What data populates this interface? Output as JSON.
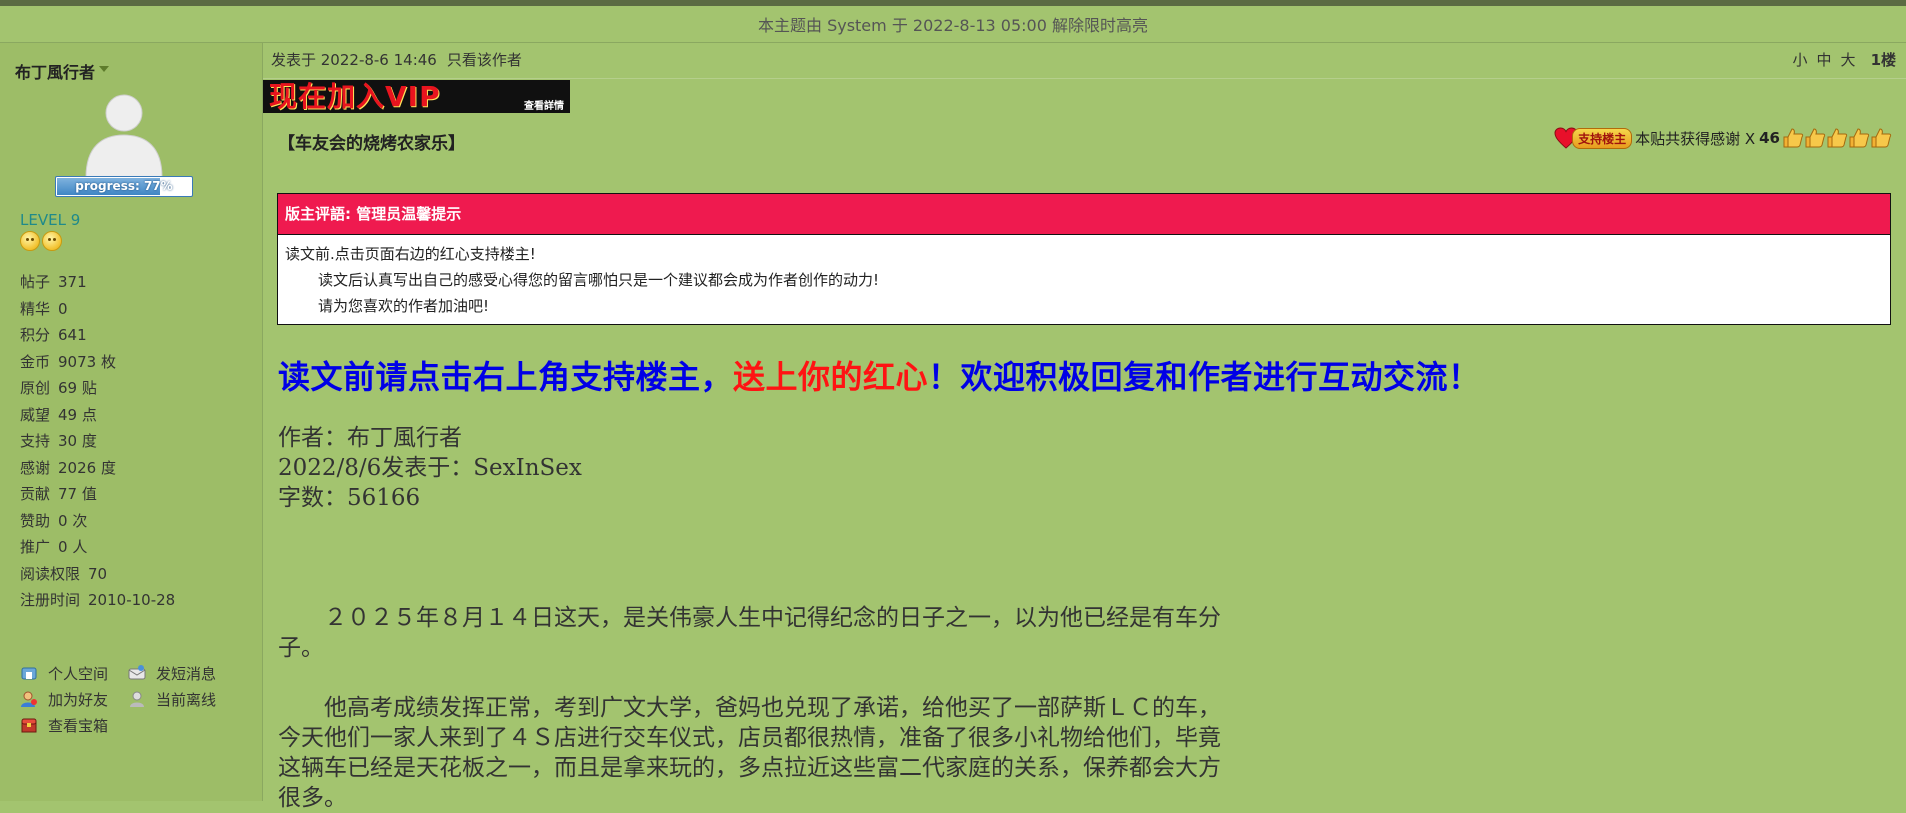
{
  "notice": "本主题由 System 于 2022-8-13 05:00 解除限时高亮",
  "author": {
    "name": "布丁風行者",
    "progress_label": "progress: 77%",
    "progress_value": 0.77,
    "level": "LEVEL 9",
    "stats": [
      {
        "key": "帖子",
        "value": "371"
      },
      {
        "key": "精华",
        "value": "0"
      },
      {
        "key": "积分",
        "value": "641"
      },
      {
        "key": "金币",
        "value": "9073 枚"
      },
      {
        "key": "原创",
        "value": "69 贴"
      },
      {
        "key": "威望",
        "value": "49 点"
      },
      {
        "key": "支持",
        "value": "30 度"
      },
      {
        "key": "感谢",
        "value": "2026 度"
      },
      {
        "key": "贡献",
        "value": "77 值"
      },
      {
        "key": "赞助",
        "value": "0 次"
      },
      {
        "key": "推广",
        "value": "0 人"
      },
      {
        "key": "阅读权限",
        "value": "70"
      },
      {
        "key": "注册时间",
        "value": "2010-10-28"
      }
    ],
    "actions": {
      "space": "个人空间",
      "message": "发短消息",
      "add_friend": "加为好友",
      "offline": "当前离线",
      "treasure": "查看宝箱"
    }
  },
  "post": {
    "meta": "发表于 2022-8-6 14:46",
    "only_author": "只看该作者",
    "font_small": "小",
    "font_mid": "中",
    "font_large": "大",
    "floor": "1楼",
    "vip_banner_text": "现在加入VIP",
    "vip_banner_small": "查看詳情",
    "title": "【车友会的烧烤农家乐】",
    "support_badge": "支持楼主",
    "thanks_text": "本贴共获得感谢 X",
    "thanks_count": "46",
    "moderator": {
      "title": "版主评語: 管理员温馨提示",
      "line1": "读文前.点击页面右边的红心支持楼主!",
      "line2": "读文后认真写出自己的感受心得您的留言哪怕只是一个建议都会成为作者创作的动力!",
      "line3": "请为您喜欢的作者加油吧!"
    },
    "banner_blue1": "读文前请点击右上角支持楼主，",
    "banner_red": "送上你的红心",
    "banner_blue2": "！欢迎积极回复和作者进行互动交流！",
    "content_author": "作者：布丁風行者",
    "content_date": "2022/8/6发表于：SexInSex",
    "content_words": "字数：56166",
    "para1": "２０２５年８月１４日这天，是关伟豪人生中记得纪念的日子之一，以为他已经是有车分子。",
    "para2": "他高考成绩发挥正常，考到广文大学，爸妈也兑现了承诺，给他买了一部萨斯ＬＣ的车，今天他们一家人来到了４Ｓ店进行交车仪式，店员都很热情，准备了很多小礼物给他们，毕竟这辆车已经是天花板之一，而且是拿来玩的，多点拉近这些富二代家庭的关系，保养都会大方很多。"
  }
}
